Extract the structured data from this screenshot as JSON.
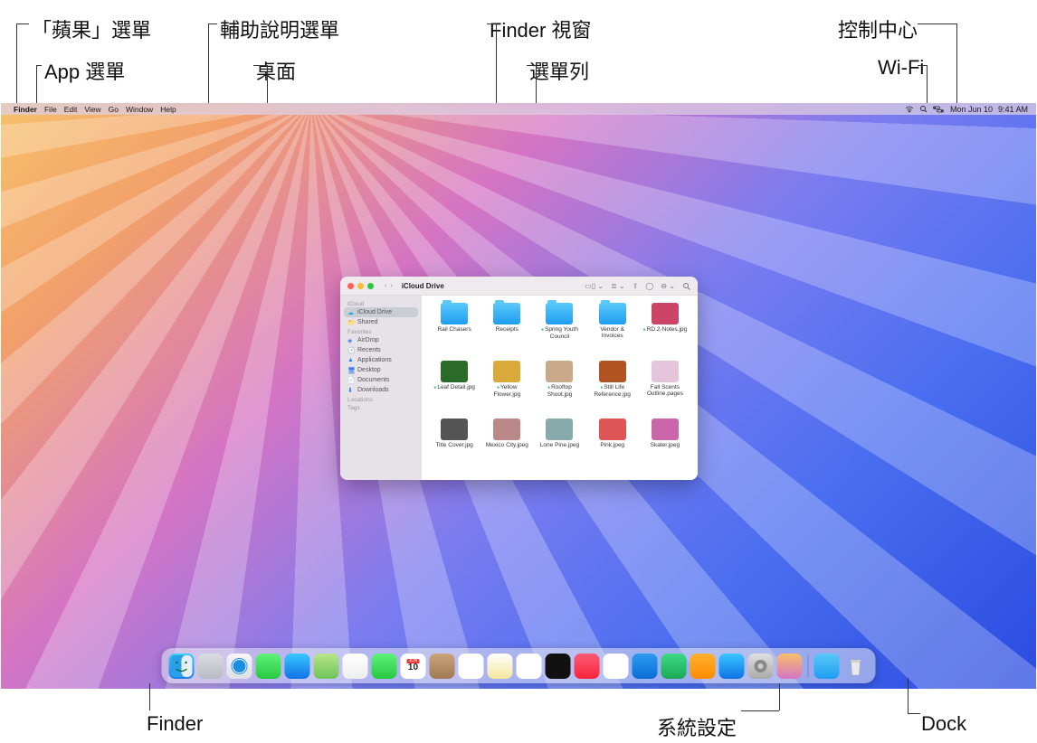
{
  "callouts": {
    "apple_menu": "「蘋果」選單",
    "app_menu": "App 選單",
    "help_menu": "輔助說明選單",
    "desktop": "桌面",
    "finder_window": "Finder 視窗",
    "menu_bar": "選單列",
    "control_center": "控制中心",
    "wifi": "Wi-Fi",
    "finder": "Finder",
    "system_settings": "系統設定",
    "dock": "Dock"
  },
  "menubar": {
    "app_name": "Finder",
    "menus": [
      "File",
      "Edit",
      "View",
      "Go",
      "Window",
      "Help"
    ],
    "date": "Mon Jun 10",
    "time": "9:41 AM"
  },
  "finder": {
    "title": "iCloud Drive",
    "sidebar": {
      "sections": [
        {
          "header": "iCloud",
          "items": [
            {
              "label": "iCloud Drive",
              "icon": "cloud",
              "selected": true
            },
            {
              "label": "Shared",
              "icon": "shared"
            }
          ]
        },
        {
          "header": "Favorites",
          "items": [
            {
              "label": "AirDrop",
              "icon": "airdrop"
            },
            {
              "label": "Recents",
              "icon": "recent"
            },
            {
              "label": "Applications",
              "icon": "apps"
            },
            {
              "label": "Desktop",
              "icon": "desk"
            },
            {
              "label": "Documents",
              "icon": "doc"
            },
            {
              "label": "Downloads",
              "icon": "dl"
            }
          ]
        },
        {
          "header": "Locations",
          "items": []
        },
        {
          "header": "Tags",
          "items": []
        }
      ]
    },
    "items": [
      {
        "label": "Rail Chasers",
        "type": "folder"
      },
      {
        "label": "Receipts",
        "type": "folder"
      },
      {
        "label": "Spring Youth Council",
        "type": "folder",
        "tagged": true
      },
      {
        "label": "Vendor & Invoices",
        "type": "folder"
      },
      {
        "label": "RD.2-Notes.jpg",
        "type": "image",
        "tagged": true,
        "bg": "#c46"
      },
      {
        "label": "Leaf Detail.jpg",
        "type": "image",
        "tagged": true,
        "bg": "#2a6b2a"
      },
      {
        "label": "Yellow Flower.jpg",
        "type": "image",
        "tagged": true,
        "bg": "#d9a93a"
      },
      {
        "label": "Rooftop Shoot.jpg",
        "type": "image",
        "tagged": true,
        "bg": "#caa98a"
      },
      {
        "label": "Still Life Reference.jpg",
        "type": "image",
        "tagged": true,
        "bg": "#b05522"
      },
      {
        "label": "Fall Scents Outline.pages",
        "type": "doc",
        "bg": "#e6c5dc"
      },
      {
        "label": "Title Cover.jpg",
        "type": "image",
        "bg": "#555"
      },
      {
        "label": "Mexico City.jpeg",
        "type": "image",
        "bg": "#b88"
      },
      {
        "label": "Lone Pine.jpeg",
        "type": "image",
        "bg": "#8aa"
      },
      {
        "label": "Pink.jpeg",
        "type": "image",
        "bg": "#d55"
      },
      {
        "label": "Skater.jpeg",
        "type": "image",
        "bg": "#c6a"
      }
    ]
  },
  "dock": {
    "apps": [
      {
        "name": "Finder",
        "bg": "linear-gradient(#3bd1f2,#1e7fe8)"
      },
      {
        "name": "Launchpad",
        "bg": "linear-gradient(#dcdde2,#b8bbc4)"
      },
      {
        "name": "Safari",
        "bg": "linear-gradient(#f6f6f7,#dfe0e3)"
      },
      {
        "name": "Messages",
        "bg": "linear-gradient(#5ef27a,#28c840)"
      },
      {
        "name": "Mail",
        "bg": "linear-gradient(#39c6ff,#1073e6)"
      },
      {
        "name": "Maps",
        "bg": "linear-gradient(#b9e588,#6ec35a)"
      },
      {
        "name": "Photos",
        "bg": "linear-gradient(#fff,#eee)"
      },
      {
        "name": "FaceTime",
        "bg": "linear-gradient(#5ef27a,#28c840)"
      },
      {
        "name": "Calendar",
        "bg": "#fff"
      },
      {
        "name": "Contacts",
        "bg": "linear-gradient(#c9a37a,#a07a55)"
      },
      {
        "name": "Reminders",
        "bg": "#fff"
      },
      {
        "name": "Notes",
        "bg": "linear-gradient(#fff,#f5e79e)"
      },
      {
        "name": "Freeform",
        "bg": "#fff"
      },
      {
        "name": "TV",
        "bg": "#111"
      },
      {
        "name": "Music",
        "bg": "linear-gradient(#fb5b74,#fa233b)"
      },
      {
        "name": "News",
        "bg": "#fff"
      },
      {
        "name": "Keynote",
        "bg": "linear-gradient(#2d9bf0,#0a6dd6)"
      },
      {
        "name": "Numbers",
        "bg": "linear-gradient(#3ed986,#1aaa55)"
      },
      {
        "name": "Pages",
        "bg": "linear-gradient(#ffb02e,#ff8c00)"
      },
      {
        "name": "App Store",
        "bg": "linear-gradient(#39c6ff,#1073e6)"
      },
      {
        "name": "System Settings",
        "bg": "linear-gradient(#e0e0e0,#a9a9a9)"
      },
      {
        "name": "iPhone Mirroring",
        "bg": "linear-gradient(#f7c06b,#d574c4)"
      }
    ],
    "right": [
      {
        "name": "Downloads",
        "bg": "linear-gradient(#5ac8fa,#1e9df0)"
      },
      {
        "name": "Trash",
        "bg": "rgba(240,240,245,0.9)"
      }
    ]
  }
}
